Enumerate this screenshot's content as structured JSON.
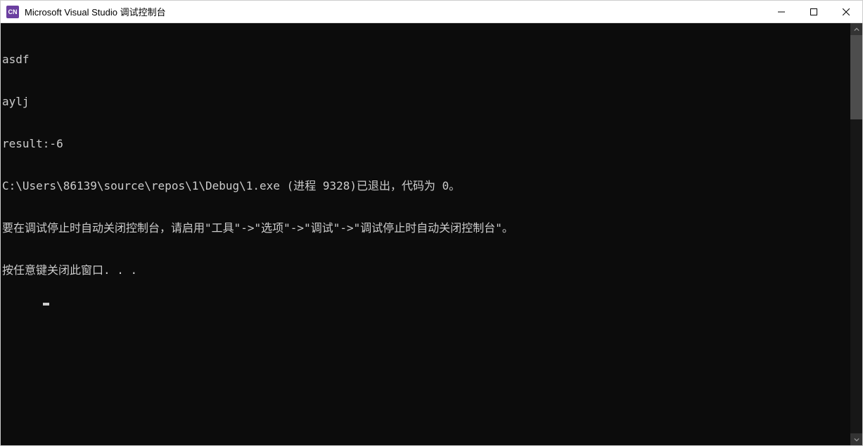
{
  "window": {
    "icon_label": "CN",
    "title": "Microsoft Visual Studio 调试控制台"
  },
  "console": {
    "lines": [
      "asdf",
      "aylj",
      "result:-6",
      "C:\\Users\\86139\\source\\repos\\1\\Debug\\1.exe (进程 9328)已退出，代码为 0。",
      "要在调试停止时自动关闭控制台，请启用\"工具\"->\"选项\"->\"调试\"->\"调试停止时自动关闭控制台\"。",
      "按任意键关闭此窗口. . ."
    ]
  }
}
